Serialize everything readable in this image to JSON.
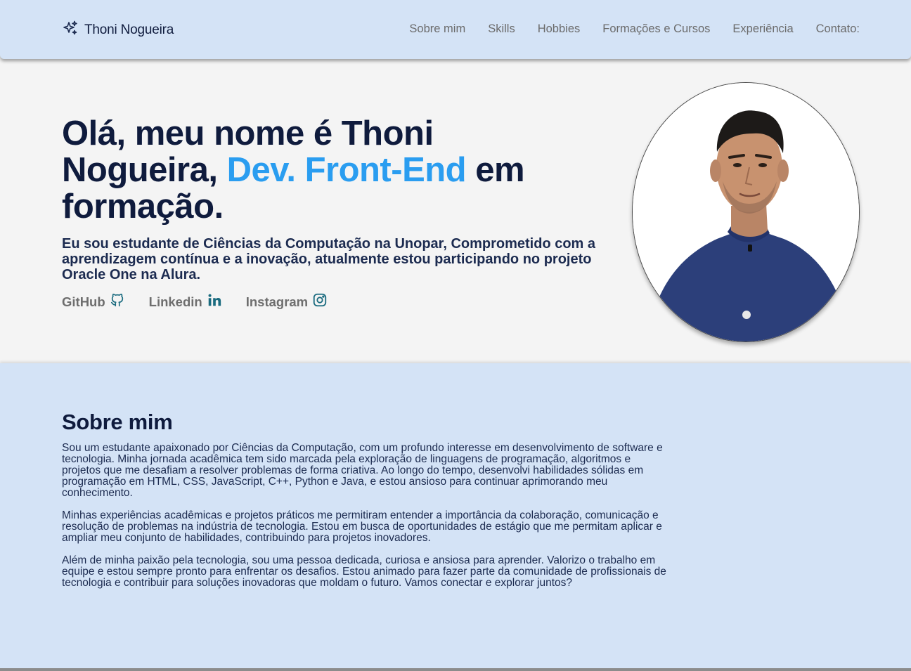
{
  "header": {
    "brand": "Thoni Nogueira",
    "brand_icon": "sparkles-icon",
    "nav": [
      {
        "label": "Sobre mim"
      },
      {
        "label": "Skills"
      },
      {
        "label": "Hobbies"
      },
      {
        "label": "Formações e Cursos"
      },
      {
        "label": "Experiência"
      },
      {
        "label": "Contato:"
      }
    ]
  },
  "hero": {
    "title_part1": "Olá, meu nome é Thoni Nogueira, ",
    "title_accent": "Dev. Front-End",
    "title_part2": " em formação.",
    "subtitle": "Eu sou estudante de Ciências da Computação na Unopar, Comprometido com a aprendizagem contínua e a inovação, atualmente estou participando no projeto Oracle One na Alura.",
    "socials": [
      {
        "label": "GitHub",
        "icon": "github-icon"
      },
      {
        "label": "Linkedin",
        "icon": "linkedin-icon"
      },
      {
        "label": "Instagram",
        "icon": "instagram-icon"
      }
    ],
    "accent_color": "#2a9df0"
  },
  "about": {
    "title": "Sobre mim",
    "paragraphs": [
      "Sou um estudante apaixonado por Ciências da Computação, com um profundo interesse em desenvolvimento de software e tecnologia. Minha jornada acadêmica tem sido marcada pela exploração de linguagens de programação, algoritmos e projetos que me desafiam a resolver problemas de forma criativa. Ao longo do tempo, desenvolvi habilidades sólidas em programação em HTML, CSS, JavaScript, C++, Python e Java, e estou ansioso para continuar aprimorando meu conhecimento.",
      "Minhas experiências acadêmicas e projetos práticos me permitiram entender a importância da colaboração, comunicação e resolução de problemas na indústria de tecnologia. Estou em busca de oportunidades de estágio que me permitam aplicar e ampliar meu conjunto de habilidades, contribuindo para projetos inovadores.",
      "Além de minha paixão pela tecnologia, sou uma pessoa dedicada, curiosa e ansiosa para aprender. Valorizo o trabalho em equipe e estou sempre pronto para enfrentar os desafios. Estou animado para fazer parte da comunidade de profissionais de tecnologia e contribuir para soluções inovadoras que moldam o futuro. Vamos conectar e explorar juntos?"
    ]
  },
  "colors": {
    "header_bg": "#d4e3f6",
    "hero_bg": "#f4f4f4",
    "text_dark": "#0f1b3d"
  }
}
